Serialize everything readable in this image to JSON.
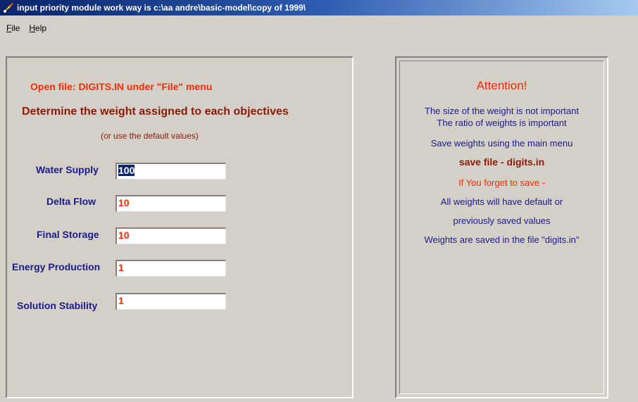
{
  "window": {
    "title": "input priority module  work way is c:\\aa andre\\basic-model\\copy of 1999\\"
  },
  "menu": {
    "file": {
      "accel": "F",
      "rest": "ile"
    },
    "help": {
      "accel": "H",
      "rest": "elp"
    }
  },
  "left_panel": {
    "open_file_text": "Open file: DIGITS.IN under \"File\" menu",
    "heading": "Determine the weight assigned to each objectives",
    "default_note": "(or use the default values)",
    "fields": [
      {
        "label": "Water Supply",
        "value": "100"
      },
      {
        "label": "Delta  Flow",
        "value": "10"
      },
      {
        "label": "Final Storage",
        "value": "10"
      },
      {
        "label": "Energy Production",
        "value": "1"
      },
      {
        "label": "Solution Stability",
        "value": "1"
      }
    ]
  },
  "right_panel": {
    "attention": "Attention!",
    "line1": "The size of the weight is not important",
    "line2": "The ratio of weights is important",
    "line3": "Save weights using the main menu",
    "save_file": "save file - digits.in",
    "warning": "If You forget to save -",
    "line4": "All weights will have default or",
    "line5": "previously saved values",
    "line6": "Weights are saved in the file \"digits.in\""
  },
  "colors": {
    "accent_red": "#ff2a00",
    "dark_red": "#8b1a0a",
    "label_blue": "#1a1a8c",
    "titlebar": "#0a246a"
  }
}
